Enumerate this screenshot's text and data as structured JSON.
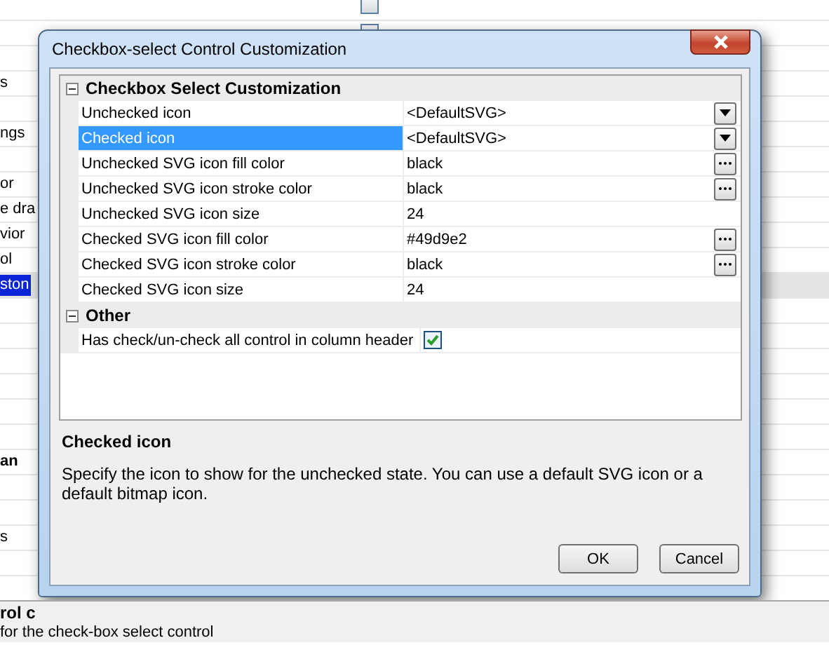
{
  "background": {
    "rows": [
      {
        "kind": "blank",
        "selected": false
      },
      {
        "kind": "blank",
        "selected": false
      },
      {
        "kind": "blank",
        "selected": false
      },
      {
        "kind": "item",
        "text": "s",
        "selected": false
      },
      {
        "kind": "blank",
        "selected": false
      },
      {
        "kind": "item",
        "text": "ngs",
        "selected": false
      },
      {
        "kind": "blank",
        "selected": false
      },
      {
        "kind": "item",
        "text": "or",
        "selected": false
      },
      {
        "kind": "item",
        "text": "e dra",
        "selected": false
      },
      {
        "kind": "item",
        "text": "vior",
        "selected": false
      },
      {
        "kind": "item",
        "text": "ol",
        "selected": false
      },
      {
        "kind": "item",
        "text": "ston",
        "selected": true
      },
      {
        "kind": "blank",
        "selected": false
      },
      {
        "kind": "blank",
        "selected": false
      },
      {
        "kind": "blank",
        "selected": false
      },
      {
        "kind": "blank",
        "selected": false
      },
      {
        "kind": "blank",
        "selected": false
      },
      {
        "kind": "blank",
        "selected": false
      },
      {
        "kind": "heading",
        "text": "an",
        "selected": false
      },
      {
        "kind": "blank",
        "selected": false
      },
      {
        "kind": "blank",
        "selected": false
      },
      {
        "kind": "item",
        "text": "s",
        "selected": false
      },
      {
        "kind": "blank",
        "selected": false
      }
    ],
    "footer": {
      "title": "rol c",
      "text": "for the check-box select control"
    }
  },
  "dialog": {
    "title": "Checkbox-select Control Customization",
    "categories": [
      {
        "name": "Checkbox Select Customization",
        "expanded": true,
        "properties": [
          {
            "name": "Unchecked icon",
            "value": "<DefaultSVG>",
            "kind": "dropdown",
            "selected": false
          },
          {
            "name": "Checked icon",
            "value": "<DefaultSVG>",
            "kind": "dropdown",
            "selected": true
          },
          {
            "name": "Unchecked SVG icon fill color",
            "value": "black",
            "kind": "ellipsis",
            "selected": false
          },
          {
            "name": "Unchecked SVG icon stroke color",
            "value": "black",
            "kind": "ellipsis",
            "selected": false
          },
          {
            "name": "Unchecked SVG icon size",
            "value": "24",
            "kind": "text",
            "selected": false
          },
          {
            "name": "Checked SVG icon fill color",
            "value": "#49d9e2",
            "kind": "ellipsis",
            "selected": false
          },
          {
            "name": "Checked SVG icon stroke color",
            "value": "black",
            "kind": "ellipsis",
            "selected": false
          },
          {
            "name": "Checked SVG icon size",
            "value": "24",
            "kind": "text",
            "selected": false
          }
        ]
      },
      {
        "name": "Other",
        "expanded": true,
        "properties": [
          {
            "name": "Has check/un-check all control in column header",
            "kind": "checkbox",
            "checked": true,
            "selected": false
          }
        ]
      }
    ],
    "description": {
      "title": "Checked icon",
      "text": "Specify the icon to show for the unchecked state. You can use a default SVG icon or a default bitmap icon."
    },
    "buttons": [
      {
        "label": "OK"
      },
      {
        "label": "Cancel"
      }
    ]
  }
}
